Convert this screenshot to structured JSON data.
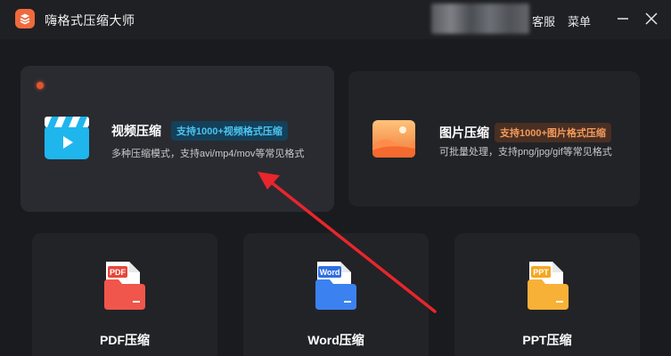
{
  "app": {
    "title": "嗨格式压缩大师"
  },
  "titlebar": {
    "service_label": "客服",
    "menu_label": "菜单"
  },
  "colors": {
    "background": "#1a1b1e",
    "card": "#222327",
    "card_active": "#2a2b31",
    "accent_orange": "#ef6a3d",
    "accent_blue": "#4cc3ee",
    "arrow_red": "#e8262c"
  },
  "features": {
    "video": {
      "title": "视频压缩",
      "badge": "支持1000+视频格式压缩",
      "desc": "多种压缩模式，支持avi/mp4/mov等常见格式",
      "icon": "video-clapper-icon"
    },
    "image": {
      "title": "图片压缩",
      "badge": "支持1000+图片格式压缩",
      "desc": "可批量处理，支持png/jpg/gif等常见格式",
      "icon": "image-icon"
    }
  },
  "tools": [
    {
      "label": "PDF压缩",
      "tag": "PDF",
      "icon": "pdf-file-icon"
    },
    {
      "label": "Word压缩",
      "tag": "Word",
      "icon": "word-file-icon"
    },
    {
      "label": "PPT压缩",
      "tag": "PPT",
      "icon": "ppt-file-icon"
    }
  ]
}
